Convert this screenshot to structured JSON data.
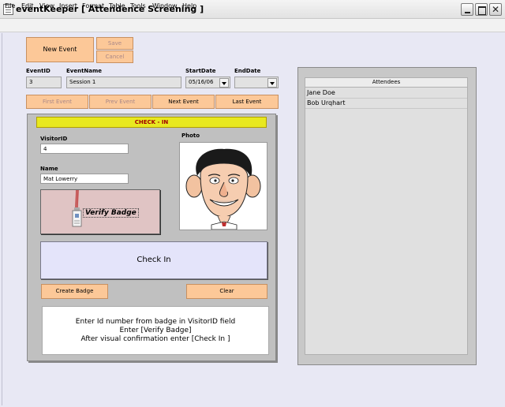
{
  "window": {
    "title": "eventKeeper [ Attendence Screening ]",
    "close_glyph": "✕"
  },
  "menu": {
    "items": [
      {
        "label": "File"
      },
      {
        "label": "Edit"
      },
      {
        "label": "View"
      },
      {
        "label": "Insert"
      },
      {
        "label": "Format"
      },
      {
        "label": "Table"
      },
      {
        "label": "Tools"
      },
      {
        "label": "Window"
      },
      {
        "label": "Help"
      }
    ]
  },
  "toolbar": {
    "new_event": "New Event",
    "save": "Save",
    "cancel": "Cancel"
  },
  "event": {
    "id_label": "EventID",
    "id_value": "3",
    "name_label": "EventName",
    "name_value": "Session 1",
    "start_label": "StartDate",
    "start_value": "05/16/06",
    "end_label": "EndDate",
    "end_value": ""
  },
  "nav": {
    "first": "First Event",
    "prev": "Prev Event",
    "next": "Next Event",
    "last": "Last Event"
  },
  "checkin": {
    "header": "CHECK - IN",
    "visitor_id_label": "VisitorID",
    "visitor_id_value": "4",
    "name_label": "Name",
    "name_value": "Mat Lowerry",
    "photo_label": "Photo",
    "verify_badge": "Verify Badge",
    "check_in": "Check In",
    "create_badge": "Create Badge",
    "clear": "Clear",
    "instructions": [
      "Enter Id number from badge in VisitorID field",
      "Enter [Verify Badge]",
      "After visual confirmation enter [Check In ]"
    ]
  },
  "attendees": {
    "header": "Attendees",
    "rows": [
      "Jane Doe",
      "Bob Urqhart"
    ]
  },
  "colors": {
    "orange_button": "#fcc898",
    "header_yellow": "#e8e820",
    "header_text": "#a00000",
    "client_bg": "#e8e8f4"
  }
}
